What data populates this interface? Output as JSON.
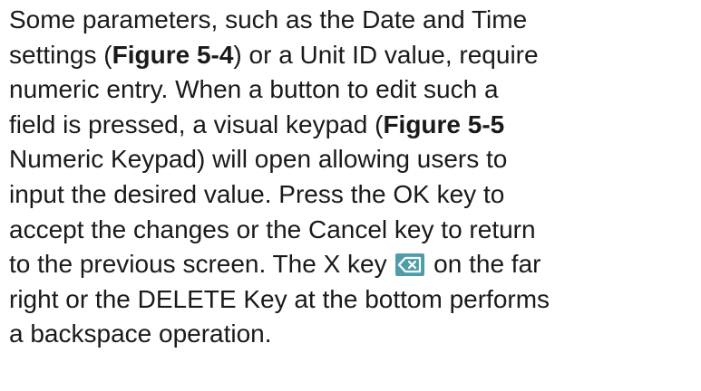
{
  "document": {
    "paragraph": {
      "l1": "Some parameters, such as the Date and Time",
      "l2_pre": "settings (",
      "l2_fig": "Figure 5-4",
      "l2_post": ") or a Unit ID value, require",
      "l3": "numeric entry. When a button to edit such a",
      "l4_pre": "field is pressed, a visual keypad (",
      "l4_fig": "Figure 5-5",
      "l5": "Numeric Keypad) will open allowing users to",
      "l6": "input the desired value. Press the OK key to",
      "l7": "accept the changes or the Cancel key to return",
      "l8": "to the previous screen. The X key",
      "l8_icon": "backspace-key-icon",
      "l8_post": "on the far",
      "l9": "right or the DELETE Key at the bottom performs",
      "l10": "a backspace operation."
    },
    "colors": {
      "text": "#1a1a1a",
      "icon_background": "#4f9daa",
      "icon_glyph": "#ffffff"
    }
  }
}
